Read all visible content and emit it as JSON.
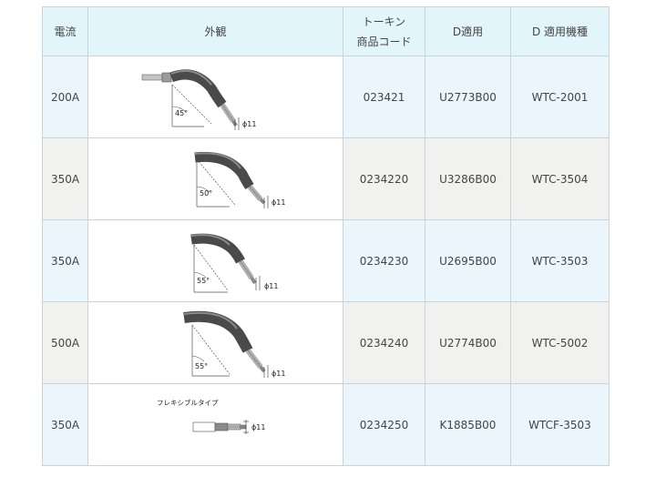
{
  "header": {
    "current": "電流",
    "appearance": "外観",
    "tokin_line1": "トーキン",
    "tokin_line2": "商品コード",
    "d_applicable": "D適用",
    "d_model": "D 適用機種"
  },
  "rows": [
    {
      "current": "200A",
      "angle": "45°",
      "dia": "ϕ11",
      "tokin": "023421",
      "d": "U2773B00",
      "model": "WTC-2001",
      "caption": ""
    },
    {
      "current": "350A",
      "angle": "50°",
      "dia": "ϕ11",
      "tokin": "0234220",
      "d": "U3286B00",
      "model": "WTC-3504",
      "caption": ""
    },
    {
      "current": "350A",
      "angle": "55°",
      "dia": "ϕ11",
      "tokin": "0234230",
      "d": "U2695B00",
      "model": "WTC-3503",
      "caption": ""
    },
    {
      "current": "500A",
      "angle": "55°",
      "dia": "ϕ11",
      "tokin": "0234240",
      "d": "U2774B00",
      "model": "WTC-5002",
      "caption": ""
    },
    {
      "current": "350A",
      "angle": "",
      "dia": "ϕ11",
      "tokin": "0234250",
      "d": "K1885B00",
      "model": "WTCF-3503",
      "caption": "フレキシブルタイプ"
    }
  ],
  "colors": {
    "header_bg": "#e2f5fa",
    "row_blue": "#eaf6fc",
    "row_gray": "#f1f2ef",
    "border": "#c9d3da"
  },
  "icons": [
    "bent-torch-neck-icon",
    "flexible-torch-neck-icon"
  ]
}
